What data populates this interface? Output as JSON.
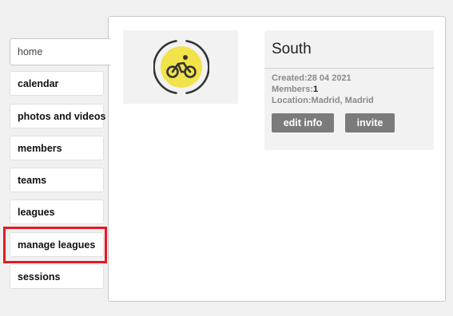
{
  "nav": {
    "items": [
      {
        "label": "home"
      },
      {
        "label": "calendar"
      },
      {
        "label": "photos and videos"
      },
      {
        "label": "members"
      },
      {
        "label": "teams"
      },
      {
        "label": "leagues"
      },
      {
        "label": "manage leagues"
      },
      {
        "label": "sessions"
      }
    ]
  },
  "team": {
    "name": "South",
    "created_label": "Created:",
    "created_value": "28 04 2021",
    "members_label": "Members:",
    "members_value": "1",
    "location_label": "Location:",
    "location_value": "Madrid, Madrid",
    "logo_icon": "cyclist-icon",
    "logo_color": "#f2e34a"
  },
  "actions": {
    "edit_label": "edit info",
    "invite_label": "invite"
  },
  "colors": {
    "highlight": "#e01b24",
    "button": "#7b7b7b"
  }
}
